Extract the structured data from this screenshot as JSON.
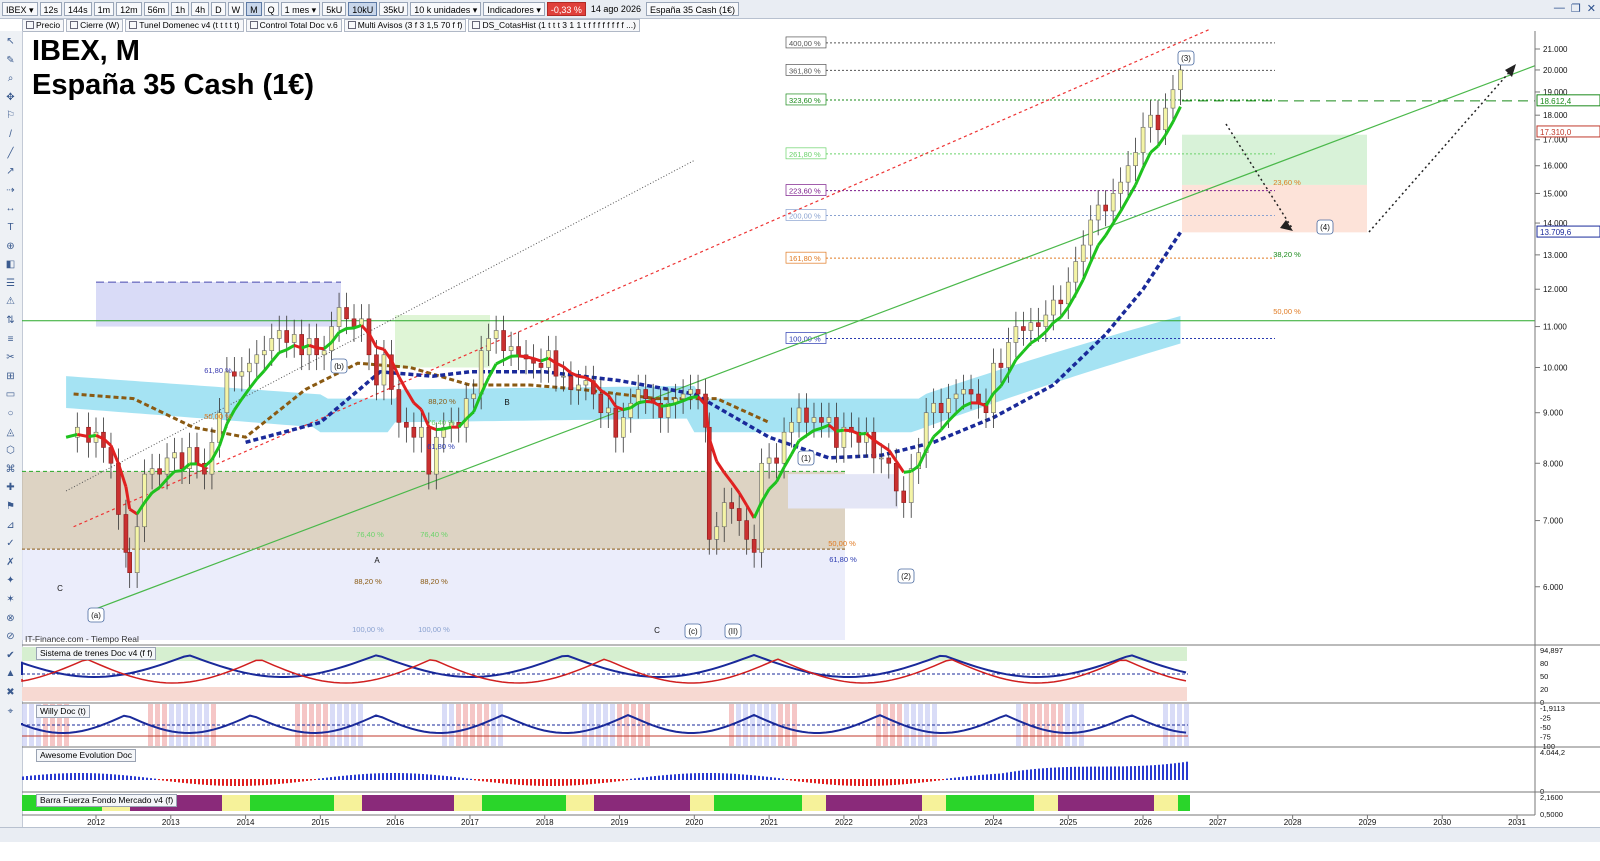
{
  "toolbar": {
    "symbol": "IBEX",
    "timeframes": [
      "12s",
      "144s",
      "1m",
      "12m",
      "56m",
      "1h",
      "4h",
      "D",
      "W",
      "M",
      "Q"
    ],
    "active_timeframe": "M",
    "range": "1 mes",
    "ticks": [
      "5kU",
      "10kU",
      "35kU"
    ],
    "active_tick": "10kU",
    "units": "10 k unidades",
    "indicators": "Indicadores",
    "change": "-0,33 %",
    "date": "14 ago 2026",
    "instrument": "España 35 Cash (1€)"
  },
  "studies": [
    "Precio",
    "Cierre (W)",
    "Tunel Domenec v4 (t t t t t)",
    "Control Total Doc v.6",
    "Multi Avisos (3 f 3 1,5 70 f f)",
    "DS_CotasHist (1 t t t 3 1 1 t f f f f f f f f ...)"
  ],
  "title": {
    "line1": "IBEX, M",
    "line2": "España 35 Cash (1€)"
  },
  "source": "IT-Finance.com - Tiempo Real",
  "colors": {
    "up": "#2a9d2a",
    "down": "#d11",
    "ema_green": "#1ec21e",
    "ema_red": "#e02020",
    "blue_dash": "#1a2a9a",
    "brown_dash": "#8a5a12",
    "cyan_band": "#8fdcf0"
  },
  "chart_data": [
    {
      "type": "candlestick",
      "name": "IBEX",
      "timeframe": "M",
      "x_axis": {
        "labels": [
          "2012",
          "2013",
          "2014",
          "2015",
          "2016",
          "2017",
          "2018",
          "2019",
          "2020",
          "2021",
          "2022",
          "2023",
          "2024",
          "2025",
          "2026",
          "2027",
          "2028",
          "2029",
          "2030",
          "2031"
        ]
      },
      "y_axis": {
        "ticks": [
          "21.000",
          "20.000",
          "19.000",
          "18.000",
          "17.000",
          "16.000",
          "15.000",
          "14.000",
          "13.000",
          "12.000",
          "11.000",
          "10.000",
          "9.000",
          "8.000",
          "7.000",
          "6.000"
        ],
        "range": [
          5300,
          21900
        ]
      },
      "price_tags": [
        {
          "label": "18.612,4",
          "value": 18612,
          "color": "#1a8a1a"
        },
        {
          "label": "17.310,0",
          "value": 17310,
          "color": "#c0392b"
        },
        {
          "label": "13.709,6",
          "value": 13709,
          "color": "#1a2a9a"
        }
      ],
      "closes": [
        [
          2011.6,
          8500
        ],
        [
          2011.75,
          8700
        ],
        [
          2011.9,
          8400
        ],
        [
          2012.0,
          8600
        ],
        [
          2012.1,
          8300
        ],
        [
          2012.2,
          8000
        ],
        [
          2012.3,
          7100
        ],
        [
          2012.4,
          6500
        ],
        [
          2012.45,
          6200
        ],
        [
          2012.55,
          6900
        ],
        [
          2012.65,
          7800
        ],
        [
          2012.75,
          7900
        ],
        [
          2012.85,
          7800
        ],
        [
          2012.95,
          8100
        ],
        [
          2013.05,
          8200
        ],
        [
          2013.15,
          7900
        ],
        [
          2013.25,
          8300
        ],
        [
          2013.35,
          8000
        ],
        [
          2013.45,
          7800
        ],
        [
          2013.55,
          8400
        ],
        [
          2013.65,
          9000
        ],
        [
          2013.75,
          9900
        ],
        [
          2013.85,
          9800
        ],
        [
          2013.95,
          9900
        ],
        [
          2014.05,
          10100
        ],
        [
          2014.15,
          10300
        ],
        [
          2014.25,
          10400
        ],
        [
          2014.35,
          10700
        ],
        [
          2014.45,
          10900
        ],
        [
          2014.55,
          10600
        ],
        [
          2014.65,
          10800
        ],
        [
          2014.75,
          10300
        ],
        [
          2014.85,
          10700
        ],
        [
          2014.95,
          10300
        ],
        [
          2015.05,
          10400
        ],
        [
          2015.15,
          11000
        ],
        [
          2015.25,
          11500
        ],
        [
          2015.35,
          11200
        ],
        [
          2015.45,
          11000
        ],
        [
          2015.55,
          11200
        ],
        [
          2015.65,
          10300
        ],
        [
          2015.75,
          9600
        ],
        [
          2015.85,
          10300
        ],
        [
          2015.95,
          9500
        ],
        [
          2016.05,
          8800
        ],
        [
          2016.15,
          8700
        ],
        [
          2016.25,
          8500
        ],
        [
          2016.35,
          8700
        ],
        [
          2016.45,
          7800
        ],
        [
          2016.55,
          8500
        ],
        [
          2016.65,
          8700
        ],
        [
          2016.75,
          8800
        ],
        [
          2016.85,
          8700
        ],
        [
          2016.95,
          9300
        ],
        [
          2017.05,
          9400
        ],
        [
          2017.15,
          10400
        ],
        [
          2017.25,
          10700
        ],
        [
          2017.35,
          10900
        ],
        [
          2017.45,
          10400
        ],
        [
          2017.55,
          10500
        ],
        [
          2017.65,
          10300
        ],
        [
          2017.75,
          10200
        ],
        [
          2017.85,
          10100
        ],
        [
          2017.95,
          10000
        ],
        [
          2018.05,
          10400
        ],
        [
          2018.15,
          9800
        ],
        [
          2018.25,
          9800
        ],
        [
          2018.35,
          9500
        ],
        [
          2018.45,
          9600
        ],
        [
          2018.55,
          9700
        ],
        [
          2018.65,
          9400
        ],
        [
          2018.75,
          9000
        ],
        [
          2018.85,
          9100
        ],
        [
          2018.95,
          8500
        ],
        [
          2019.05,
          8900
        ],
        [
          2019.15,
          9200
        ],
        [
          2019.25,
          9500
        ],
        [
          2019.35,
          9300
        ],
        [
          2019.45,
          9200
        ],
        [
          2019.55,
          8900
        ],
        [
          2019.65,
          9200
        ],
        [
          2019.75,
          9300
        ],
        [
          2019.85,
          9400
        ],
        [
          2019.95,
          9500
        ],
        [
          2020.05,
          9400
        ],
        [
          2020.15,
          8700
        ],
        [
          2020.2,
          6700
        ],
        [
          2020.3,
          6900
        ],
        [
          2020.4,
          7300
        ],
        [
          2020.5,
          7200
        ],
        [
          2020.6,
          7000
        ],
        [
          2020.7,
          6700
        ],
        [
          2020.8,
          6500
        ],
        [
          2020.9,
          8000
        ],
        [
          2021.0,
          8100
        ],
        [
          2021.1,
          8000
        ],
        [
          2021.2,
          8600
        ],
        [
          2021.3,
          8800
        ],
        [
          2021.4,
          9100
        ],
        [
          2021.5,
          8800
        ],
        [
          2021.6,
          8900
        ],
        [
          2021.7,
          8800
        ],
        [
          2021.8,
          8900
        ],
        [
          2021.9,
          8300
        ],
        [
          2022.0,
          8700
        ],
        [
          2022.1,
          8600
        ],
        [
          2022.2,
          8400
        ],
        [
          2022.3,
          8600
        ],
        [
          2022.4,
          8100
        ],
        [
          2022.5,
          8100
        ],
        [
          2022.6,
          8000
        ],
        [
          2022.7,
          7500
        ],
        [
          2022.8,
          7300
        ],
        [
          2022.9,
          7900
        ],
        [
          2023.0,
          8200
        ],
        [
          2023.1,
          9000
        ],
        [
          2023.2,
          9200
        ],
        [
          2023.3,
          9000
        ],
        [
          2023.4,
          9300
        ],
        [
          2023.5,
          9400
        ],
        [
          2023.6,
          9500
        ],
        [
          2023.7,
          9400
        ],
        [
          2023.8,
          9200
        ],
        [
          2023.9,
          9000
        ],
        [
          2024.0,
          10100
        ],
        [
          2024.1,
          10000
        ],
        [
          2024.2,
          10600
        ],
        [
          2024.3,
          11000
        ],
        [
          2024.4,
          10900
        ],
        [
          2024.5,
          11100
        ],
        [
          2024.6,
          11000
        ],
        [
          2024.7,
          11300
        ],
        [
          2024.8,
          11700
        ],
        [
          2024.9,
          11600
        ],
        [
          2025.0,
          12200
        ],
        [
          2025.1,
          12800
        ],
        [
          2025.2,
          13300
        ],
        [
          2025.3,
          14100
        ],
        [
          2025.4,
          14600
        ],
        [
          2025.5,
          14400
        ],
        [
          2025.6,
          15000
        ],
        [
          2025.7,
          15400
        ],
        [
          2025.8,
          16000
        ],
        [
          2025.9,
          16500
        ],
        [
          2026.0,
          17500
        ],
        [
          2026.1,
          18000
        ],
        [
          2026.2,
          17400
        ],
        [
          2026.3,
          18300
        ],
        [
          2026.4,
          19100
        ],
        [
          2026.5,
          20000
        ]
      ],
      "fibonacci_levels": [
        {
          "label": "400,00 %",
          "value": 21300
        },
        {
          "label": "361,80 %",
          "value": 19980
        },
        {
          "label": "323,60 %",
          "value": 18650
        },
        {
          "label": "261,80 %",
          "value": 16450
        },
        {
          "label": "223,60 %",
          "value": 15100
        },
        {
          "label": "200,00 %",
          "value": 14250
        },
        {
          "label": "161,80 %",
          "value": 12900
        },
        {
          "label": "100,00 %",
          "value": 10700
        }
      ],
      "retracement_labels": [
        "61,80 %",
        "50,00 %",
        "88,20 %",
        "76,40 %",
        "61,80 %",
        "76,40 %",
        "76,40 %",
        "88,20 %",
        "88,20 %",
        "100,00 %",
        "100,00 %",
        "50,00 %",
        "61,80 %",
        "23,60 %",
        "38,20 %",
        "50,00 %"
      ],
      "wave_labels": [
        "(a)",
        "(b)",
        "(c)",
        "(II)",
        "(1)",
        "(2)",
        "(3)",
        "(4)",
        "A",
        "B",
        "C",
        "C"
      ],
      "horizontal_line": 11150
    },
    {
      "type": "line",
      "name": "Sistema de trenes Doc v4 (f f)",
      "y_axis": {
        "ticks": [
          "94,897",
          "80",
          "50",
          "20",
          "0"
        ]
      }
    },
    {
      "type": "bar",
      "name": "Willy Doc (t)",
      "y_axis": {
        "ticks": [
          "-1,9113",
          "-25",
          "-50",
          "-75",
          "-100"
        ]
      }
    },
    {
      "type": "bar",
      "name": "Awesome Evolution Doc",
      "y_axis": {
        "ticks": [
          "4.044,2",
          "0"
        ]
      }
    },
    {
      "type": "heatmap",
      "name": "Barra Fuerza Fondo Mercado v4 (f)",
      "y_axis": {
        "ticks": [
          "2,1600",
          "0,5000"
        ]
      }
    }
  ]
}
